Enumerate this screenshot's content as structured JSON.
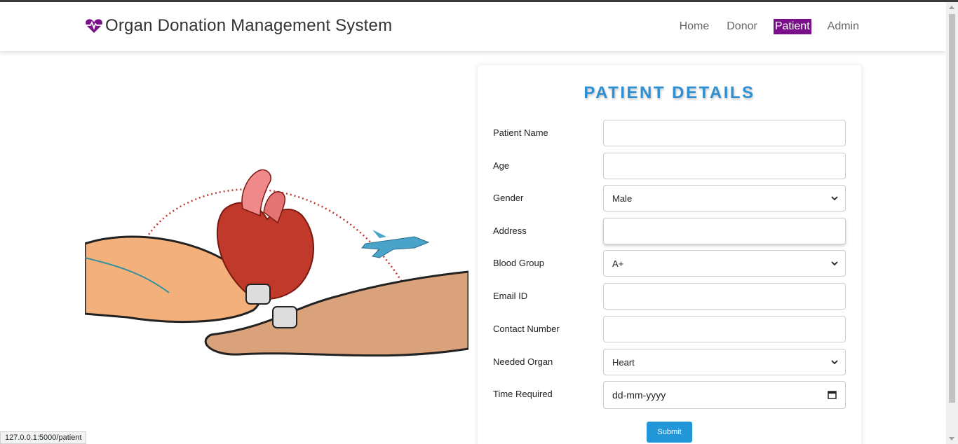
{
  "brand": {
    "title": "Organ Donation Management System",
    "icon": "heartbeat-icon",
    "color": "#7a0f8a"
  },
  "nav": {
    "items": [
      {
        "label": "Home",
        "active": false
      },
      {
        "label": "Donor",
        "active": false
      },
      {
        "label": "Patient",
        "active": true
      },
      {
        "label": "Admin",
        "active": false
      }
    ]
  },
  "form": {
    "title": "PATIENT DETAILS",
    "fields": [
      {
        "label": "Patient Name",
        "type": "text",
        "value": ""
      },
      {
        "label": "Age",
        "type": "text",
        "value": ""
      },
      {
        "label": "Gender",
        "type": "select",
        "value": "Male"
      },
      {
        "label": "Address",
        "type": "text",
        "value": ""
      },
      {
        "label": "Blood Group",
        "type": "select",
        "value": "A+"
      },
      {
        "label": "Email ID",
        "type": "text",
        "value": ""
      },
      {
        "label": "Contact Number",
        "type": "text",
        "value": ""
      },
      {
        "label": "Needed Organ",
        "type": "select",
        "value": "Heart"
      },
      {
        "label": "Time Required",
        "type": "date",
        "value": "dd-mm-yyyy"
      }
    ],
    "submit_label": "Submit"
  },
  "status_bar": {
    "url": "127.0.0.1:5000/patient"
  },
  "colors": {
    "accent": "#2f8fd3",
    "active_nav": "#7a0f8a",
    "button": "#2196d8"
  }
}
